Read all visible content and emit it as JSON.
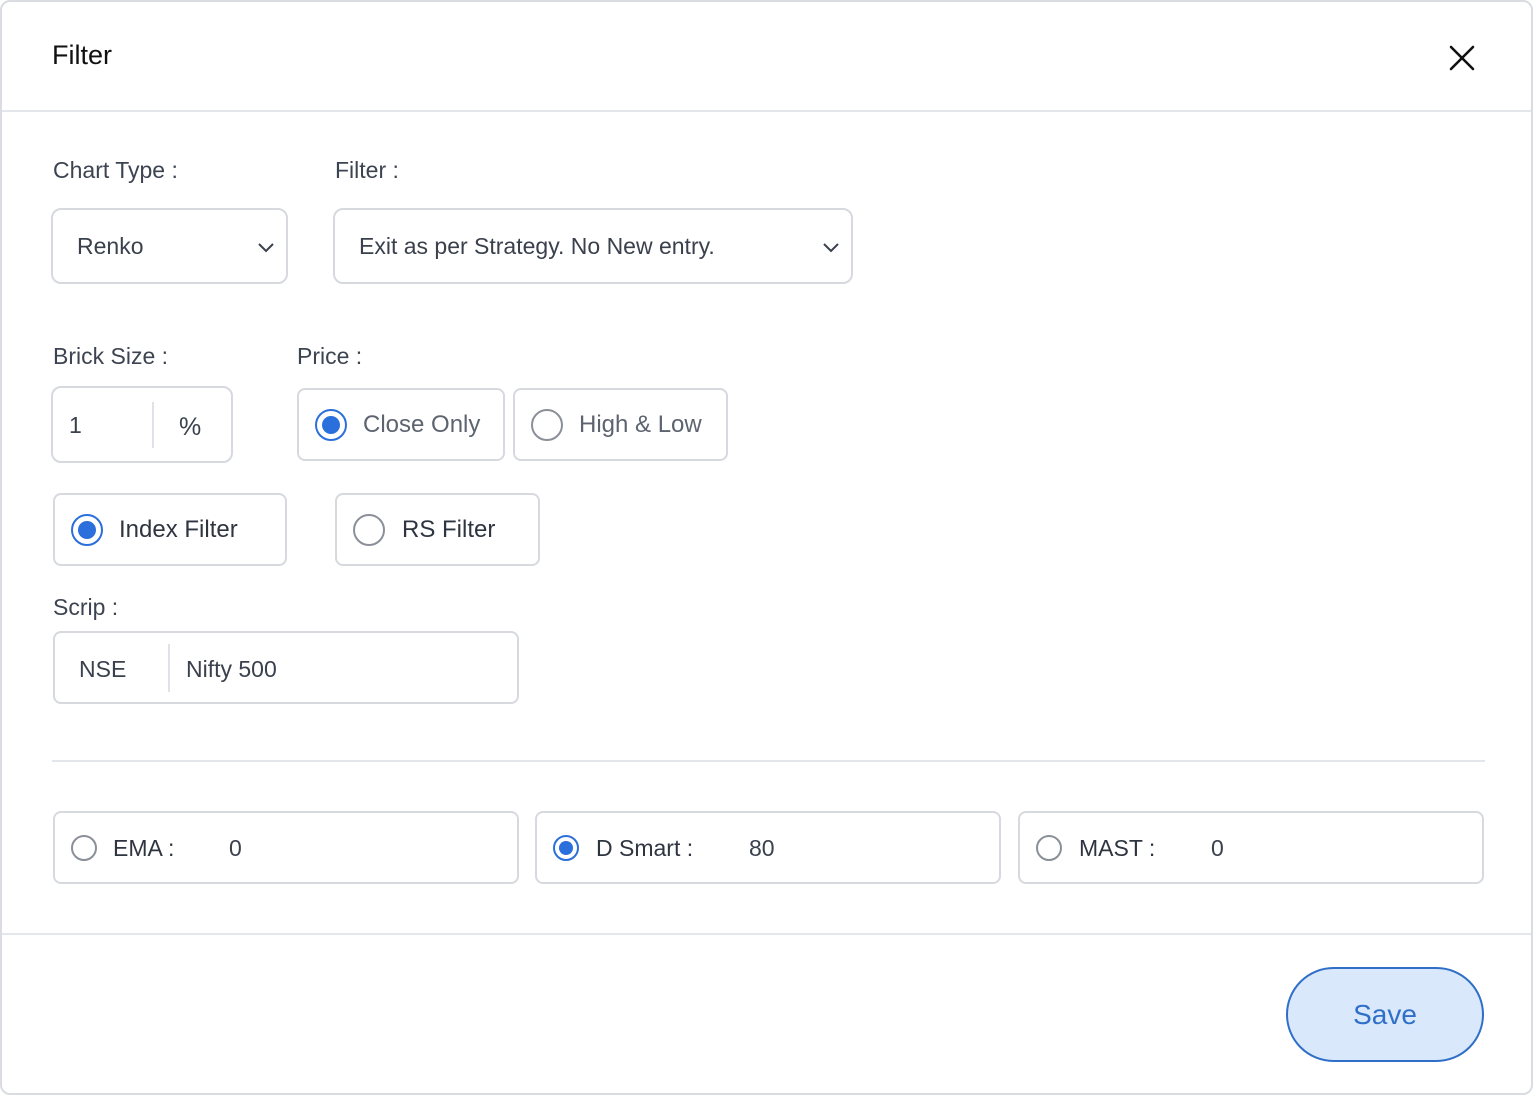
{
  "dialog": {
    "title": "Filter",
    "close_icon": "close-icon"
  },
  "chart_type": {
    "label": "Chart Type :",
    "value": "Renko",
    "icon": "chevron-down-icon"
  },
  "filter": {
    "label": "Filter :",
    "value": "Exit as per Strategy. No New entry.",
    "icon": "chevron-down-icon"
  },
  "brick_size": {
    "label": "Brick Size :",
    "value": "1",
    "unit": "%"
  },
  "price": {
    "label": "Price :",
    "options": [
      {
        "label": "Close Only",
        "checked": true
      },
      {
        "label": "High & Low",
        "checked": false
      }
    ]
  },
  "filter_mode": {
    "options": [
      {
        "label": "Index Filter",
        "checked": true
      },
      {
        "label": "RS Filter",
        "checked": false
      }
    ]
  },
  "scrip": {
    "label": "Scrip :",
    "exchange": "NSE",
    "name": "Nifty 500"
  },
  "indicators": [
    {
      "label": "EMA :",
      "value": "0",
      "checked": false
    },
    {
      "label": "D Smart :",
      "value": "80",
      "checked": true
    },
    {
      "label": "MAST :",
      "value": "0",
      "checked": false
    }
  ],
  "footer": {
    "save_label": "Save"
  },
  "colors": {
    "accent": "#2a6fdb",
    "save_bg": "#d9e8fb",
    "border": "#d6d9de"
  }
}
